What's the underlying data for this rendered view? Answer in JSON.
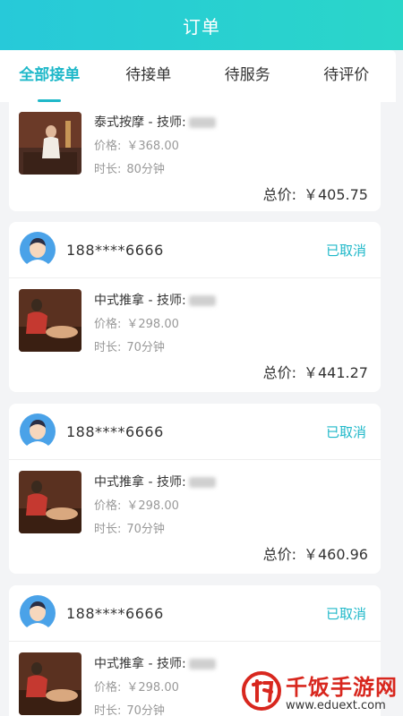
{
  "header": {
    "title": "订单"
  },
  "tabs": [
    {
      "label": "全部接单",
      "active": true
    },
    {
      "label": "待接单",
      "active": false
    },
    {
      "label": "待服务",
      "active": false
    },
    {
      "label": "待评价",
      "active": false
    }
  ],
  "orders": [
    {
      "service_title": "泰式按摩 - 技师:",
      "price_label": "价格:",
      "price": "￥368.00",
      "duration_label": "时长:",
      "duration": "80分钟",
      "total_label": "总价:",
      "total": "￥405.75"
    },
    {
      "phone": "188****6666",
      "status": "已取消",
      "service_title": "中式推拿 - 技师:",
      "price_label": "价格:",
      "price": "￥298.00",
      "duration_label": "时长:",
      "duration": "70分钟",
      "total_label": "总价:",
      "total": "￥441.27"
    },
    {
      "phone": "188****6666",
      "status": "已取消",
      "service_title": "中式推拿 - 技师:",
      "price_label": "价格:",
      "price": "￥298.00",
      "duration_label": "时长:",
      "duration": "70分钟",
      "total_label": "总价:",
      "total": "￥460.96"
    },
    {
      "phone": "188****6666",
      "status": "已取消",
      "service_title": "中式推拿 - 技师:",
      "price_label": "价格:",
      "price": "￥298.00",
      "duration_label": "时长:",
      "duration": "70分钟"
    }
  ],
  "watermark": {
    "text": "千饭手游网",
    "url": "www.eduext.com"
  },
  "colors": {
    "accent": "#1fb8c9",
    "header_start": "#27c9d9",
    "header_end": "#2ad6c9",
    "watermark": "#d8271e"
  }
}
